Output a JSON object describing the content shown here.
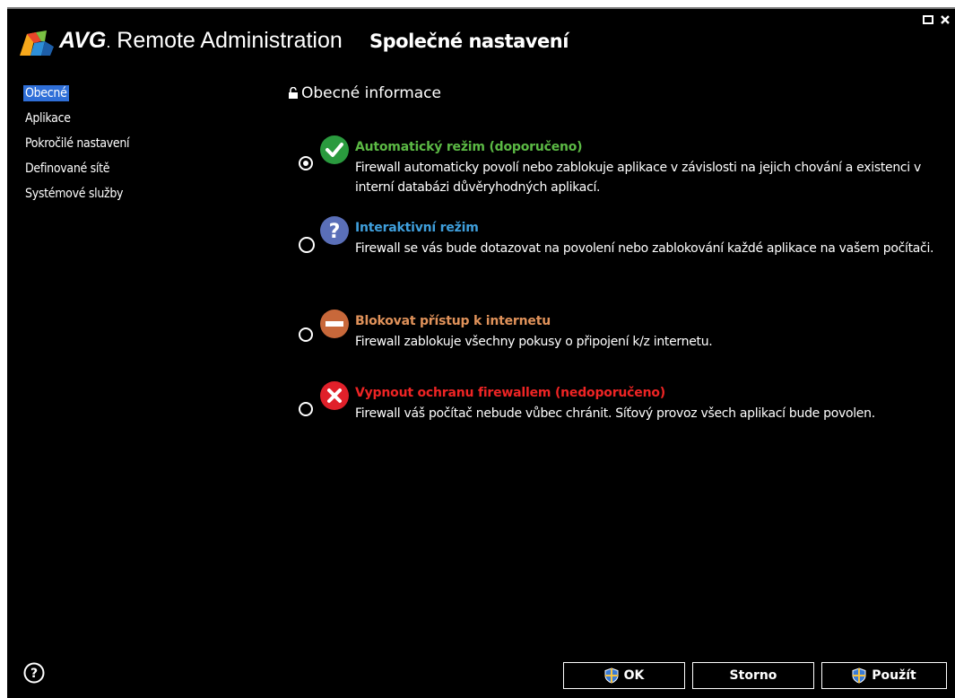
{
  "app": {
    "brand_bold": "AVG",
    "brand_dot": ".",
    "brand_rest": " Remote Administration",
    "dialog_title": "Společné nastavení",
    "window_buttons": [
      "restore-icon",
      "close-icon"
    ]
  },
  "sidebar": {
    "items": [
      {
        "label": "Obecné",
        "active": true
      },
      {
        "label": "Aplikace",
        "active": false
      },
      {
        "label": "Pokročilé nastavení",
        "active": false
      },
      {
        "label": "Definované sítě",
        "active": false
      },
      {
        "label": "Systémové služby",
        "active": false
      }
    ]
  },
  "main": {
    "section_title": "Obecné informace",
    "options": [
      {
        "title": "Automatický režim (doporučeno)",
        "description": "Firewall automaticky povolí nebo zablokuje aplikace v závislosti na jejich chování a existenci v interní databázi důvěryhodných aplikací.",
        "selected": true,
        "icon": "check-icon",
        "color": "#5bb944"
      },
      {
        "title": "Interaktivní režim",
        "description": "Firewall se vás bude dotazovat na povolení nebo zablokování každé aplikace na vašem počítači.",
        "selected": false,
        "icon": "question-icon",
        "color": "#3f9fdc"
      },
      {
        "title": "Blokovat přístup k internetu",
        "description": "Firewall zablokuje všechny pokusy o připojení k/z internetu.",
        "selected": false,
        "icon": "block-icon",
        "color": "#e0925a"
      },
      {
        "title": "Vypnout ochranu firewallem (nedoporučeno)",
        "description": "Firewall váš počítač nebude vůbec chránit. Síťový provoz všech aplikací bude povolen.",
        "selected": false,
        "icon": "error-icon",
        "color": "#ee2424"
      }
    ]
  },
  "footer": {
    "help_icon": "help-icon",
    "ok_label": "OK",
    "cancel_label": "Storno",
    "apply_label": "Použít"
  }
}
